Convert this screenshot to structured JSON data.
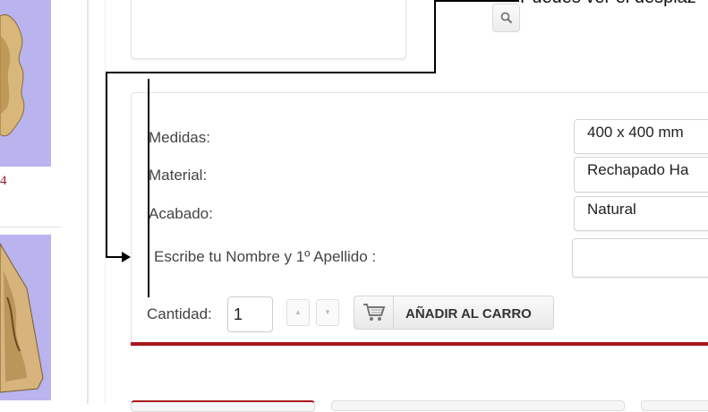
{
  "sidebar": {
    "product_number": "4"
  },
  "callout": {
    "text": "Puedes ver el desplaz"
  },
  "options": {
    "medidas_label": "Medidas:",
    "medidas_value": "400 x 400 mm",
    "material_label": "Material:",
    "material_value": "Rechapado Ha",
    "acabado_label": "Acabado:",
    "acabado_value": "Natural",
    "name_label": "Escribe tu Nombre y 1º Apellido :",
    "name_value": ""
  },
  "cart": {
    "quantity_label": "Cantidad:",
    "quantity_value": "1",
    "add_button_label": "AÑADIR AL CARRO"
  },
  "colors": {
    "accent": "#a8161e",
    "thumbnail_bg": "#b9b4ee",
    "product_number": "#9b1c2b"
  }
}
